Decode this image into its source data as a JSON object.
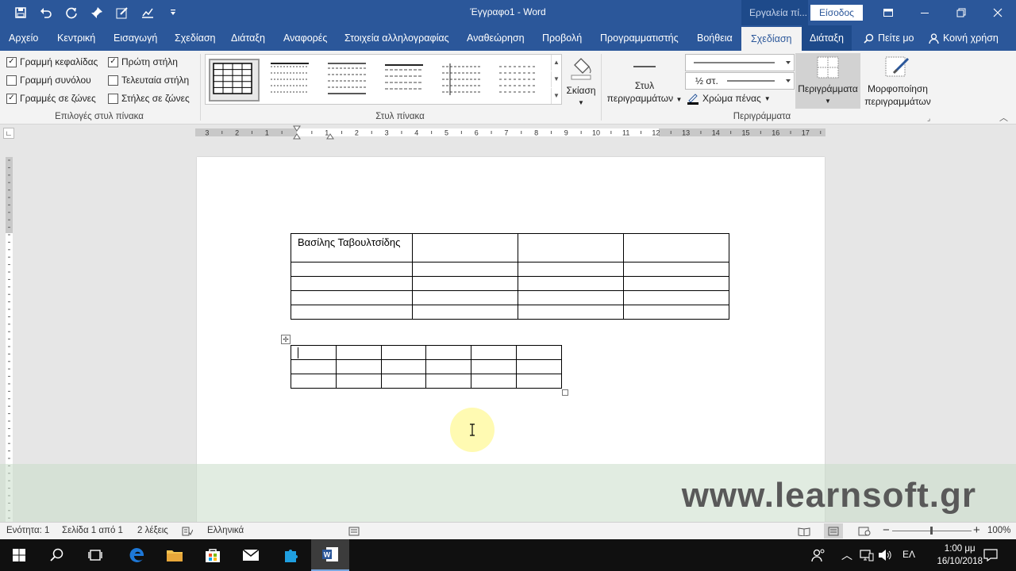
{
  "window": {
    "doc_title": "Έγγραφο1  -  Word",
    "tools_label": "Εργαλεία πί...",
    "signin": "Είσοδος"
  },
  "tabs": [
    {
      "label": "Αρχείο"
    },
    {
      "label": "Κεντρική"
    },
    {
      "label": "Εισαγωγή"
    },
    {
      "label": "Σχεδίαση"
    },
    {
      "label": "Διάταξη"
    },
    {
      "label": "Αναφορές"
    },
    {
      "label": "Στοιχεία αλληλογραφίας"
    },
    {
      "label": "Αναθεώρηση"
    },
    {
      "label": "Προβολή"
    },
    {
      "label": "Προγραμματιστής"
    },
    {
      "label": "Βοήθεια"
    },
    {
      "label": "Σχεδίαση"
    },
    {
      "label": "Διάταξη"
    }
  ],
  "tellme": "Πείτε μο",
  "share": "Κοινή χρήση",
  "ribbon": {
    "options": [
      {
        "label": "Γραμμή κεφαλίδας",
        "checked": true
      },
      {
        "label": "Γραμμή συνόλου",
        "checked": false
      },
      {
        "label": "Γραμμές σε ζώνες",
        "checked": true
      },
      {
        "label": "Πρώτη στήλη",
        "checked": true
      },
      {
        "label": "Τελευταία στήλη",
        "checked": false
      },
      {
        "label": "Στήλες σε ζώνες",
        "checked": false
      }
    ],
    "check_mark": "✓",
    "group_options": "Επιλογές στυλ πίνακα",
    "group_styles": "Στυλ πίνακα",
    "group_borders": "Περιγράμματα",
    "shading": "Σκίαση",
    "border_styles_1": "Στυλ",
    "border_styles_2": "περιγραμμάτων",
    "weight": "½ στ.",
    "pen_color": "Χρώμα πένας",
    "borders": "Περιγράμματα",
    "border_painter_1": "Μορφοποίηση",
    "border_painter_2": "περιγραμμάτων"
  },
  "ruler": {
    "labels": [
      "3",
      "2",
      "1",
      "1",
      "2",
      "3",
      "4",
      "5",
      "6",
      "7",
      "8",
      "9",
      "10",
      "11",
      "12",
      "13",
      "14",
      "15",
      "16",
      "17"
    ]
  },
  "doc": {
    "table1": {
      "rows": [
        [
          "Βασίλης Ταβουλτσίδης",
          "",
          "",
          ""
        ],
        [
          "",
          "",
          "",
          ""
        ],
        [
          "",
          "",
          "",
          ""
        ],
        [
          "",
          "",
          "",
          ""
        ],
        [
          "",
          "",
          "",
          ""
        ]
      ]
    },
    "table2": {
      "rows": [
        [
          "",
          "",
          "",
          "",
          "",
          ""
        ],
        [
          "",
          "",
          "",
          "",
          "",
          ""
        ],
        [
          "",
          "",
          "",
          "",
          "",
          ""
        ]
      ]
    }
  },
  "watermark": "www.learnsoft.gr",
  "status": {
    "section": "Ενότητα: 1",
    "page": "Σελίδα 1 από 1",
    "words": "2 λέξεις",
    "language": "Ελληνικά",
    "zoom": "100%"
  },
  "taskbar": {
    "lang": "ΕΛ",
    "time": "1:00 μμ",
    "date": "16/10/2018"
  },
  "colors": {
    "word_blue": "#2b579a",
    "taskbar": "#101010"
  }
}
